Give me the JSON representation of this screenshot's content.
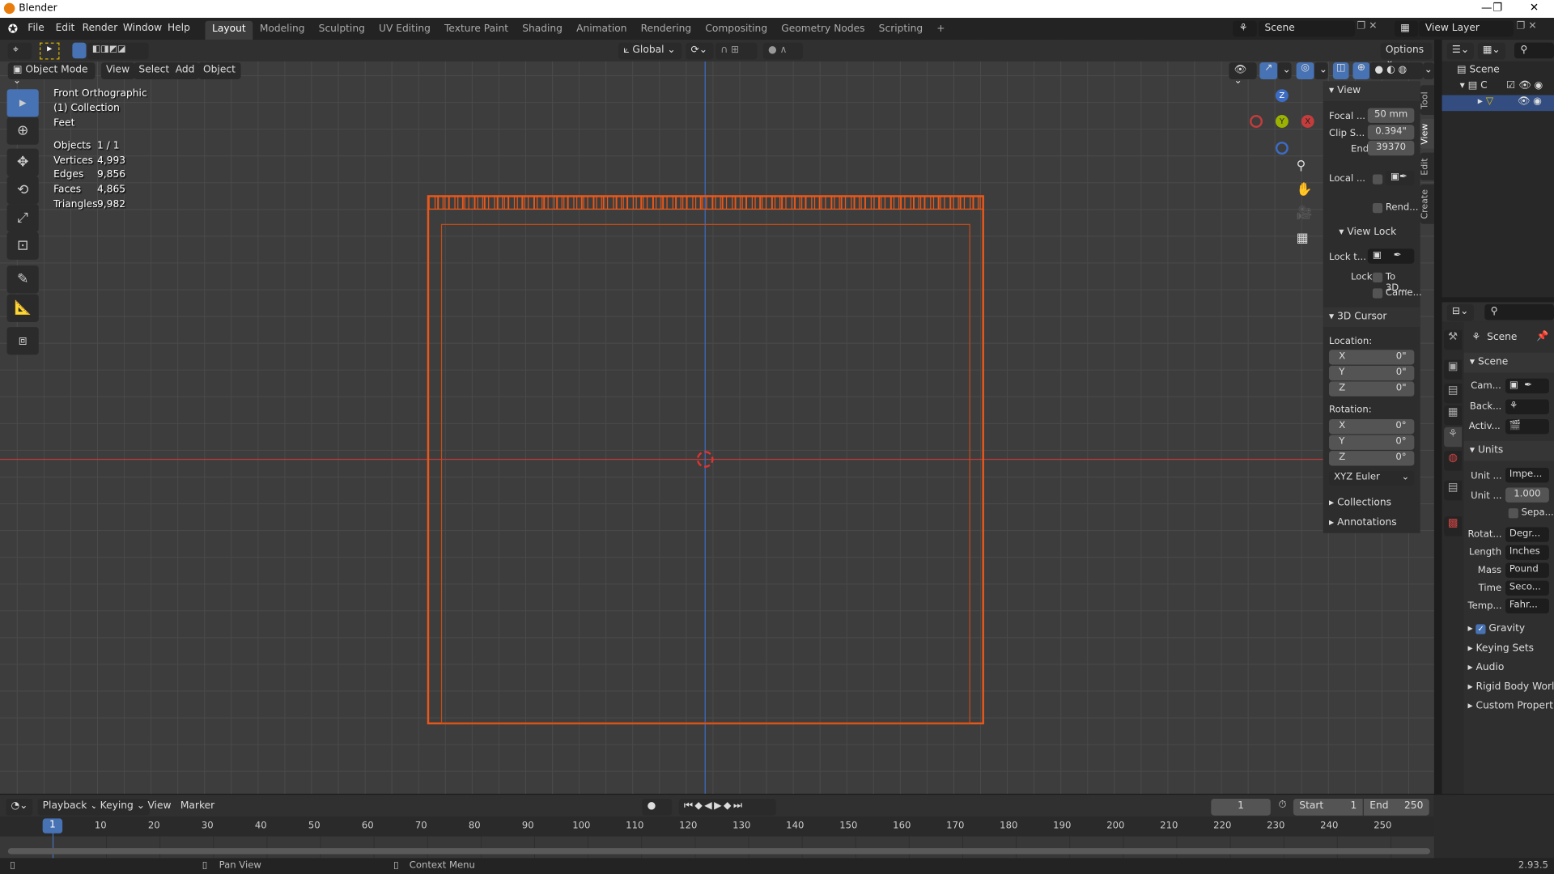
{
  "window": {
    "title": "Blender",
    "minimize": "—",
    "maximize": "❐",
    "close": "✕"
  },
  "menu": [
    "File",
    "Edit",
    "Render",
    "Window",
    "Help"
  ],
  "workspaces": [
    "Layout",
    "Modeling",
    "Sculpting",
    "UV Editing",
    "Texture Paint",
    "Shading",
    "Animation",
    "Rendering",
    "Compositing",
    "Geometry Nodes",
    "Scripting",
    "+"
  ],
  "active_workspace": "Layout",
  "scene": {
    "label": "Scene",
    "view_layer": "View Layer"
  },
  "tool_header": {
    "orientation": "Global",
    "options": "Options"
  },
  "viewport_header": {
    "mode": "Object Mode",
    "menus": [
      "View",
      "Select",
      "Add",
      "Object"
    ]
  },
  "overlay_info": {
    "view": "Front Orthographic",
    "collection": "(1) Collection",
    "units": "Feet",
    "stats": [
      {
        "label": "Objects",
        "value": "1 / 1"
      },
      {
        "label": "Vertices",
        "value": "4,993"
      },
      {
        "label": "Edges",
        "value": "9,856"
      },
      {
        "label": "Faces",
        "value": "4,865"
      },
      {
        "label": "Triangles",
        "value": "9,982"
      }
    ]
  },
  "gizmo": {
    "z": "Z",
    "y": "Y",
    "x": "X"
  },
  "npanel": {
    "tabs": [
      "Tool",
      "View",
      "Edit",
      "Create"
    ],
    "active_tab": "View",
    "view": {
      "title": "View",
      "focal_label": "Focal ...",
      "focal": "50 mm",
      "clip_start_label": "Clip S...",
      "clip_start": "0.394\"",
      "clip_end_label": "End",
      "clip_end": "39370",
      "local_label": "Local ...",
      "render_label": "Rend..."
    },
    "view_lock": {
      "title": "View Lock",
      "lock_to_label": "Lock t...",
      "lock_label": "Lock",
      "to_3d": "To 3D...",
      "camera": "Came..."
    },
    "cursor": {
      "title": "3D Cursor",
      "location": "Location:",
      "rotation": "Rotation:",
      "loc": [
        {
          "axis": "X",
          "value": "0\""
        },
        {
          "axis": "Y",
          "value": "0\""
        },
        {
          "axis": "Z",
          "value": "0\""
        }
      ],
      "rot": [
        {
          "axis": "X",
          "value": "0°"
        },
        {
          "axis": "Y",
          "value": "0°"
        },
        {
          "axis": "Z",
          "value": "0°"
        }
      ],
      "mode": "XYZ Euler"
    },
    "collections": "Collections",
    "annotations": "Annotations"
  },
  "outliner": {
    "scene": "Scene",
    "collection": "C"
  },
  "properties": {
    "context": "Scene",
    "scene_panel": "Scene",
    "camera": "Cam...",
    "background": "Back...",
    "active_clip": "Activ...",
    "units_panel": "Units",
    "units": [
      {
        "label": "Unit ...",
        "value": "Impe..."
      },
      {
        "label": "Unit ...",
        "value": "1.000"
      }
    ],
    "separate": "Sepa...",
    "unit_rows": [
      {
        "label": "Rotat...",
        "value": "Degr..."
      },
      {
        "label": "Length",
        "value": "Inches"
      },
      {
        "label": "Mass",
        "value": "Pound"
      },
      {
        "label": "Time",
        "value": "Seco..."
      },
      {
        "label": "Temp...",
        "value": "Fahr..."
      }
    ],
    "collapsed": [
      "Gravity",
      "Keying Sets",
      "Audio",
      "Rigid Body World",
      "Custom Properties"
    ],
    "gravity_checked": true
  },
  "timeline": {
    "menus": [
      "Playback",
      "Keying",
      "View",
      "Marker"
    ],
    "current_frame": "1",
    "start_label": "Start",
    "start": "1",
    "end_label": "End",
    "end": "250",
    "ticks": [
      "10",
      "20",
      "30",
      "40",
      "50",
      "60",
      "70",
      "80",
      "90",
      "100",
      "110",
      "120",
      "130",
      "140",
      "150",
      "160",
      "170",
      "180",
      "190",
      "200",
      "210",
      "220",
      "230",
      "240",
      "250"
    ]
  },
  "status": {
    "pan": "Pan View",
    "context": "Context Menu",
    "version": "2.93.5"
  },
  "colors": {
    "accent": "#4772b3",
    "selection": "#e8581a",
    "x_axis": "#c43c3c",
    "z_axis": "#3c6cc4"
  }
}
